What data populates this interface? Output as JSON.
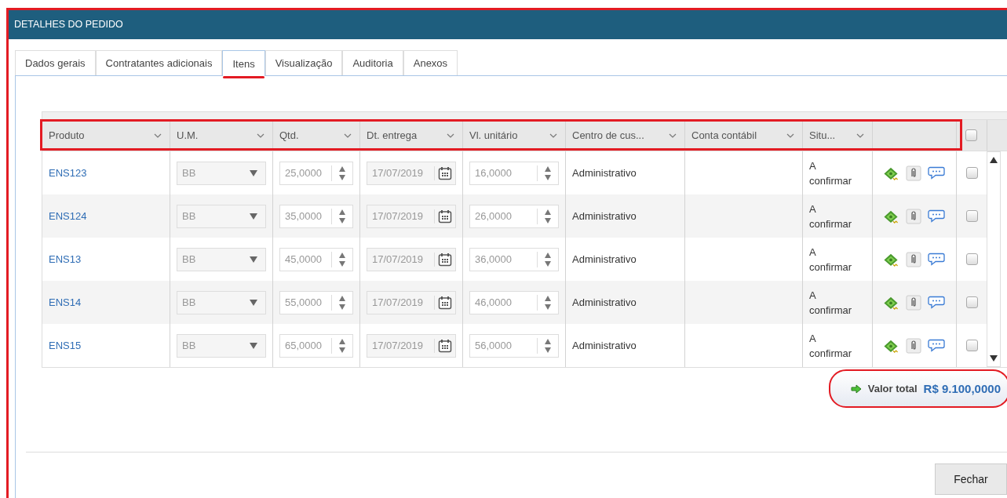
{
  "window": {
    "title": "DETALHES DO PEDIDO"
  },
  "tabs": [
    {
      "label": "Dados gerais",
      "selected": false
    },
    {
      "label": "Contratantes adicionais",
      "selected": false
    },
    {
      "label": "Itens",
      "selected": true
    },
    {
      "label": "Visualização",
      "selected": false
    },
    {
      "label": "Auditoria",
      "selected": false
    },
    {
      "label": "Anexos",
      "selected": false
    }
  ],
  "table": {
    "columns": [
      {
        "label": "Produto"
      },
      {
        "label": "U.M."
      },
      {
        "label": "Qtd."
      },
      {
        "label": "Dt. entrega"
      },
      {
        "label": "Vl. unitário"
      },
      {
        "label": "Centro de cus..."
      },
      {
        "label": "Conta contábil"
      },
      {
        "label": "Situ..."
      }
    ],
    "select_all_checked": false,
    "rows": [
      {
        "product": "ENS123",
        "unit": "BB",
        "quantity": "25,0000",
        "delivery_date": "17/07/2019",
        "unit_price": "16,0000",
        "cost_center": "Administrativo",
        "status": "A confirmar",
        "checked": false
      },
      {
        "product": "ENS124",
        "unit": "BB",
        "quantity": "35,0000",
        "delivery_date": "17/07/2019",
        "unit_price": "26,0000",
        "cost_center": "Administrativo",
        "status": "A confirmar",
        "checked": false
      },
      {
        "product": "ENS13",
        "unit": "BB",
        "quantity": "45,0000",
        "delivery_date": "17/07/2019",
        "unit_price": "36,0000",
        "cost_center": "Administrativo",
        "status": "A confirmar",
        "checked": false
      },
      {
        "product": "ENS14",
        "unit": "BB",
        "quantity": "55,0000",
        "delivery_date": "17/07/2019",
        "unit_price": "46,0000",
        "cost_center": "Administrativo",
        "status": "A confirmar",
        "checked": false
      },
      {
        "product": "ENS15",
        "unit": "BB",
        "quantity": "65,0000",
        "delivery_date": "17/07/2019",
        "unit_price": "56,0000",
        "cost_center": "Administrativo",
        "status": "A confirmar",
        "checked": false
      }
    ]
  },
  "total": {
    "label": "Valor total",
    "value": "R$ 9.100,0000"
  },
  "buttons": [
    {
      "label": "Fechar"
    }
  ]
}
